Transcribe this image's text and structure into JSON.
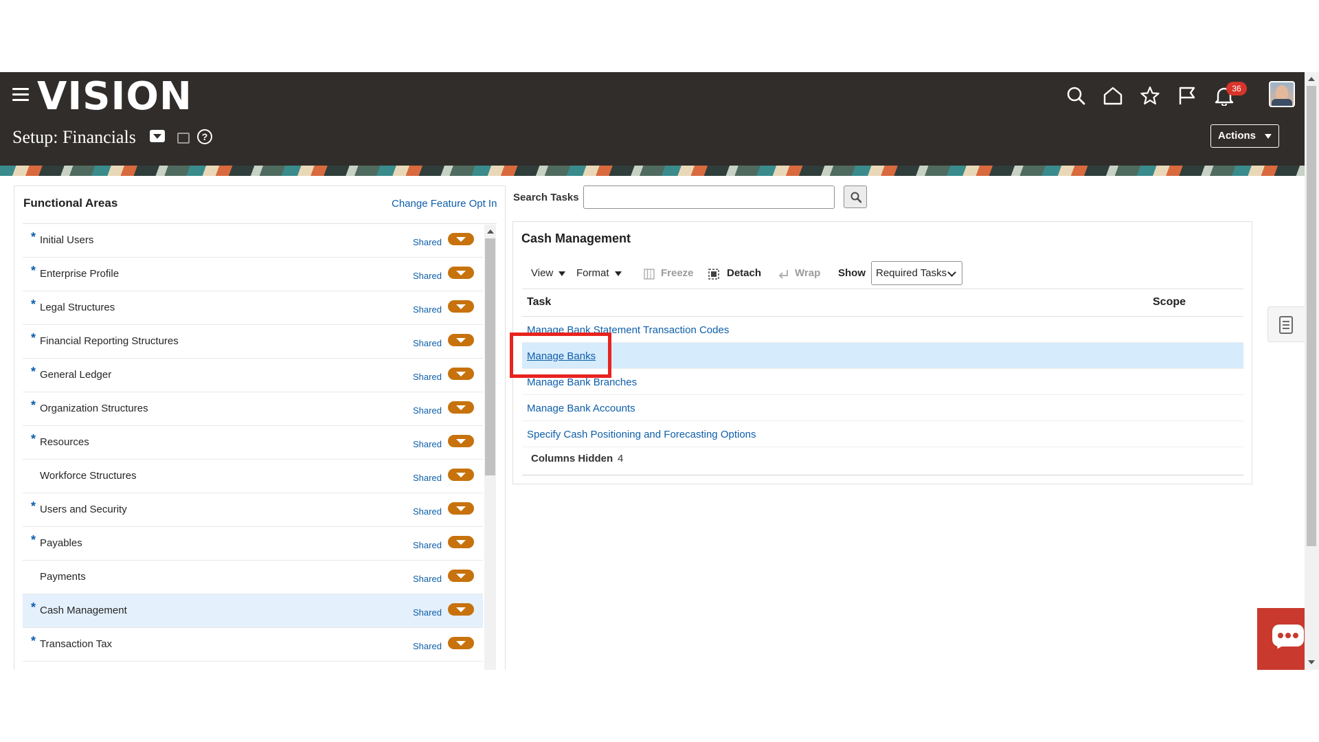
{
  "header": {
    "logo": "VISION",
    "page_title": "Setup: Financials",
    "notifications_count": "36",
    "actions_label": "Actions"
  },
  "functional_areas": {
    "title": "Functional Areas",
    "change_link": "Change Feature Opt In",
    "items": [
      {
        "label": "Initial Users",
        "required": true,
        "status": "Shared"
      },
      {
        "label": "Enterprise Profile",
        "required": true,
        "status": "Shared"
      },
      {
        "label": "Legal Structures",
        "required": true,
        "status": "Shared"
      },
      {
        "label": "Financial Reporting Structures",
        "required": true,
        "status": "Shared"
      },
      {
        "label": "General Ledger",
        "required": true,
        "status": "Shared"
      },
      {
        "label": "Organization Structures",
        "required": true,
        "status": "Shared"
      },
      {
        "label": "Resources",
        "required": true,
        "status": "Shared"
      },
      {
        "label": "Workforce Structures",
        "required": false,
        "status": "Shared"
      },
      {
        "label": "Users and Security",
        "required": true,
        "status": "Shared"
      },
      {
        "label": "Payables",
        "required": true,
        "status": "Shared"
      },
      {
        "label": "Payments",
        "required": false,
        "status": "Shared"
      },
      {
        "label": "Cash Management",
        "required": true,
        "status": "Shared",
        "selected": true
      },
      {
        "label": "Transaction Tax",
        "required": true,
        "status": "Shared"
      }
    ]
  },
  "search": {
    "label": "Search Tasks",
    "value": ""
  },
  "cash_management": {
    "title": "Cash Management",
    "toolbar": {
      "view": "View",
      "format": "Format",
      "freeze": "Freeze",
      "detach": "Detach",
      "wrap": "Wrap",
      "show_label": "Show",
      "show_value": "Required Tasks"
    },
    "columns": {
      "task": "Task",
      "scope": "Scope"
    },
    "tasks": [
      {
        "label": "Manage Bank Statement Transaction Codes"
      },
      {
        "label": "Manage Banks",
        "selected": true
      },
      {
        "label": "Manage Bank Branches"
      },
      {
        "label": "Manage Bank Accounts"
      },
      {
        "label": "Specify Cash Positioning and Forecasting Options"
      }
    ],
    "columns_hidden_label": "Columns Hidden",
    "columns_hidden_count": "4"
  },
  "colors": {
    "header_bg": "#312d2a",
    "link": "#0d5ea9",
    "shared_button": "#c7720c",
    "selected_row": "#d6ebfc",
    "highlight": "#e8231f",
    "chat": "#c9392e"
  },
  "icons": [
    "menu-icon",
    "search-icon",
    "home-icon",
    "star-icon",
    "flag-icon",
    "bell-icon",
    "help-icon",
    "tasklist-icon",
    "chat-icon"
  ]
}
